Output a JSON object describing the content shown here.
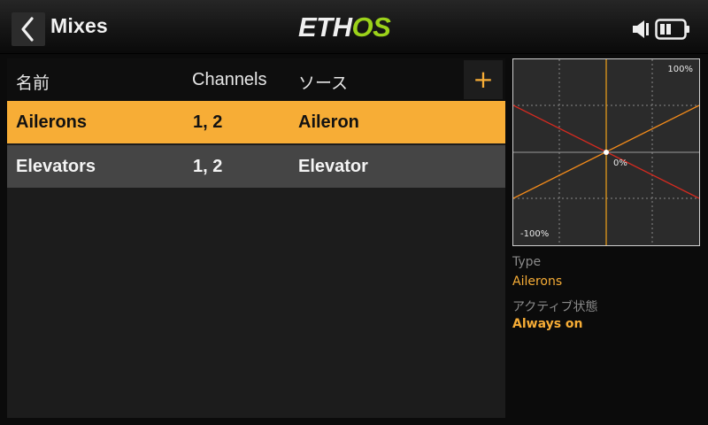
{
  "header": {
    "title": "Mixes",
    "logo_main": "ETH",
    "logo_accent": "OS"
  },
  "table": {
    "columns": [
      "名前",
      "Channels",
      "ソース"
    ],
    "add_label": "+",
    "rows": [
      {
        "name": "Ailerons",
        "channels": "1, 2",
        "source": "Aileron",
        "selected": true
      },
      {
        "name": "Elevators",
        "channels": "1, 2",
        "source": "Elevator",
        "selected": false
      }
    ]
  },
  "preview": {
    "max_label": "100%",
    "min_label": "-100%",
    "zero_label": "0%"
  },
  "info": {
    "type_label": "Type",
    "type_value": "Ailerons",
    "active_label": "アクティブ状態",
    "active_value": "Always on"
  },
  "icons": {
    "back": "chevron-left-icon",
    "add": "plus-icon",
    "volume": "speaker-icon",
    "battery": "battery-icon"
  },
  "colors": {
    "accent": "#f7ad36",
    "logo_green": "#9bd21a",
    "curve_rising": "#f28a1a",
    "curve_falling": "#d42a20",
    "center_line": "#f2a21a"
  }
}
